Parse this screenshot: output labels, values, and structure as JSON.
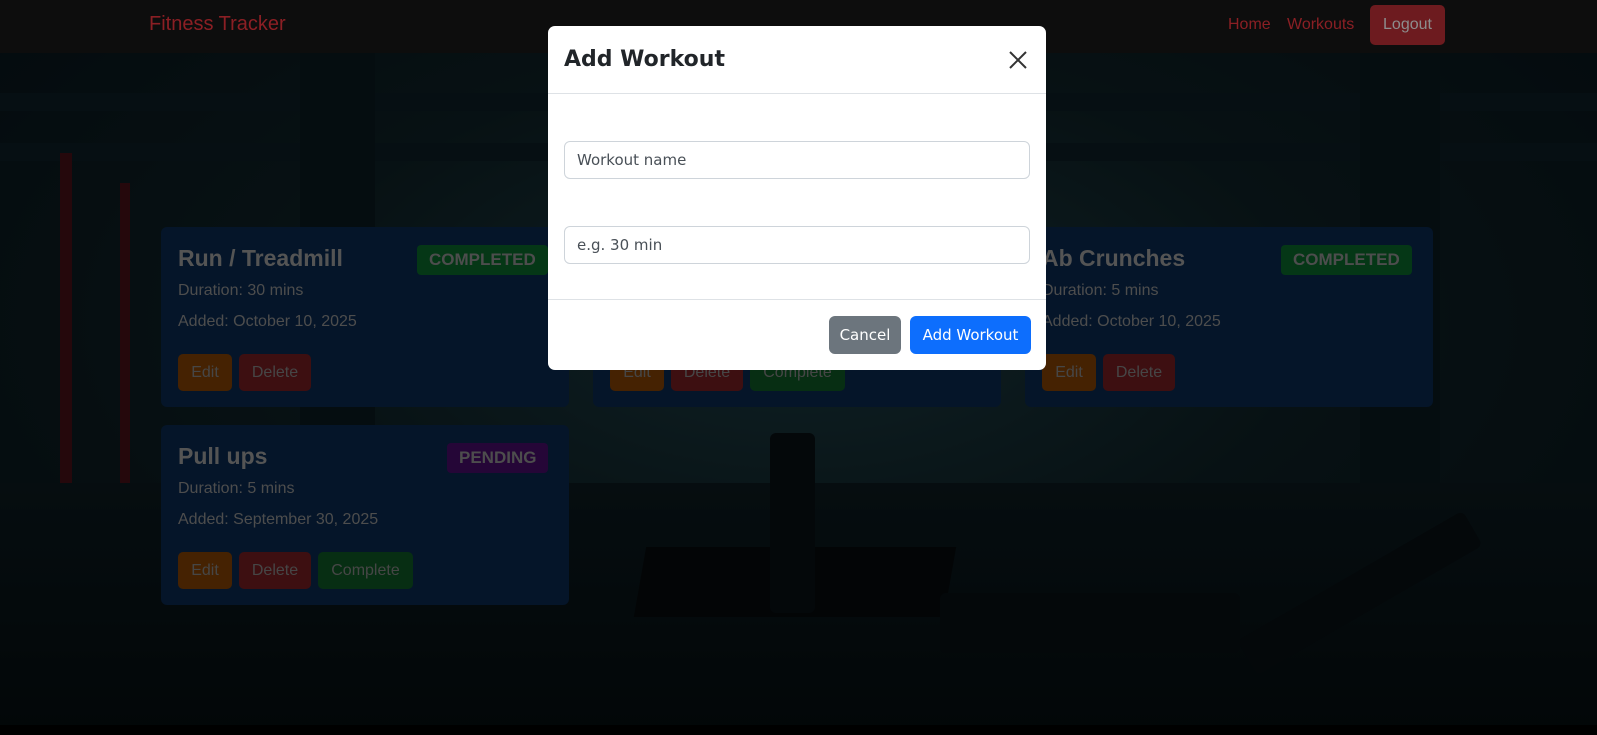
{
  "navbar": {
    "brand": "Fitness Tracker",
    "links": [
      "Home",
      "Workouts"
    ],
    "logout_label": "Logout"
  },
  "cards": [
    {
      "title": "Run / Treadmill",
      "status": "COMPLETED",
      "duration": "Duration: 30 mins",
      "added": "Added: October 10, 2025",
      "edit_label": "Edit",
      "delete_label": "Delete"
    },
    {
      "title": "",
      "status": "",
      "edit_label": "Edit",
      "delete_label": "Delete",
      "complete_label": "Complete"
    },
    {
      "title": "Ab Crunches",
      "status": "COMPLETED",
      "duration": "Duration: 5 mins",
      "added": "Added: October 10, 2025",
      "edit_label": "Edit",
      "delete_label": "Delete"
    },
    {
      "title": "Pull ups",
      "status": "PENDING",
      "duration": "Duration: 5 mins",
      "added": "Added: September 30, 2025",
      "edit_label": "Edit",
      "delete_label": "Delete",
      "complete_label": "Complete"
    }
  ],
  "modal": {
    "title": "Add Workout",
    "close_icon": "close-icon",
    "name_placeholder": "Workout name",
    "duration_placeholder": "e.g. 30 min",
    "cancel_label": "Cancel",
    "submit_label": "Add Workout"
  },
  "colors": {
    "brand": "#8b1f24",
    "card_bg": "#0a2b52",
    "completed": "#0a6e2d",
    "pending": "#4b0d6e",
    "primary": "#0d6efd",
    "secondary": "#6c757d"
  }
}
